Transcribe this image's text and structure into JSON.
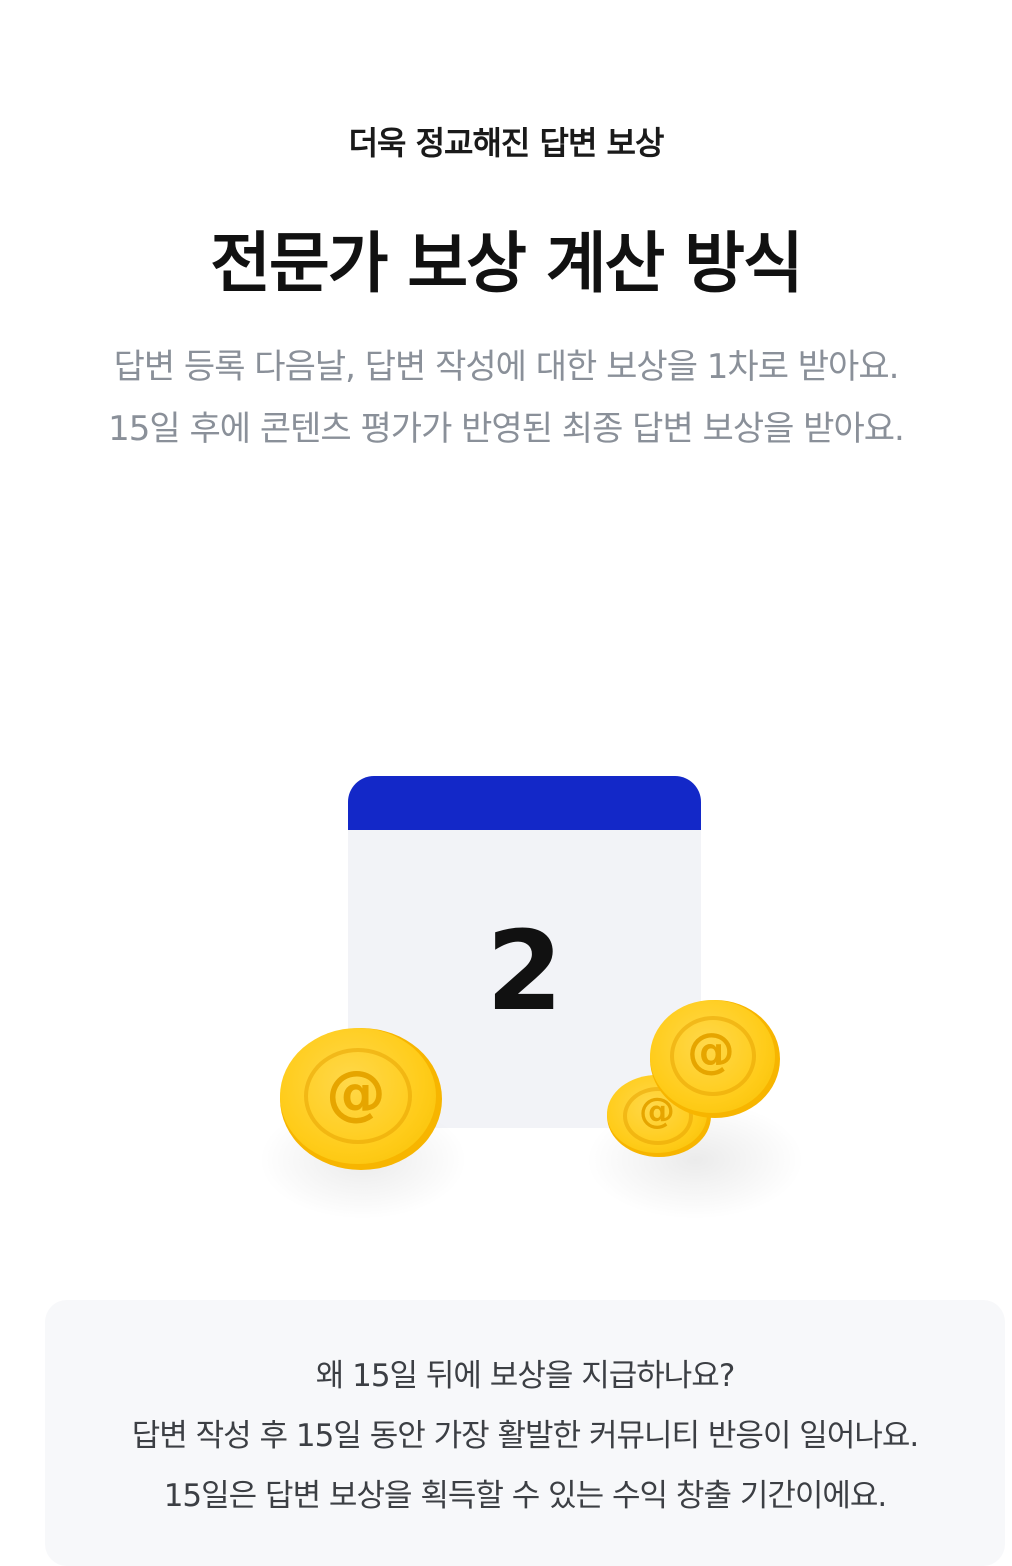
{
  "eyebrow": "더욱 정교해진 답변 보상",
  "title": "전문가 보상 계산 방식",
  "description": [
    "답변 등록 다음날, 답변 작성에 대한 보상을 1차로 받아요.",
    "15일 후에 콘텐츠 평가가 반영된 최종 답변 보상을 받아요."
  ],
  "calendar": {
    "day": "2",
    "header_color": "#1328c8"
  },
  "coin_mark": "@",
  "info": {
    "question": "왜 15일 뒤에 보상을 지급하나요?",
    "line1": "답변 작성 후 15일 동안 가장 활발한 커뮤니티 반응이 일어나요.",
    "line2": "15일은 답변 보상을 획득할 수 있는 수익 창출 기간이에요."
  }
}
